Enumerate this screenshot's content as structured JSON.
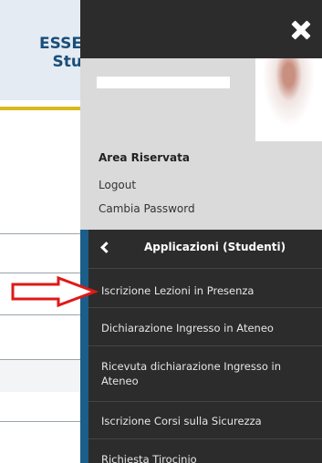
{
  "background": {
    "title_lines": [
      "ESSE",
      "Stu"
    ]
  },
  "menu": {
    "user": {
      "section_title": "Area Riservata",
      "logout": "Logout",
      "change_password": "Cambia Password"
    },
    "submenu": {
      "title": "Applicazioni (Studenti)",
      "items": [
        {
          "label": "Iscrizione Lezioni in Presenza"
        },
        {
          "label": "Dichiarazione Ingresso in Ateneo"
        },
        {
          "label": "Ricevuta dichiarazione Ingresso in Ateneo"
        },
        {
          "label": "Iscrizione Corsi sulla Sicurezza"
        },
        {
          "label": "Richiesta Tirocinio"
        }
      ]
    }
  },
  "colors": {
    "panel_bg": "#2c2c2c",
    "accent_blue": "#1b5e8a",
    "arrow_red": "#e01818",
    "user_area_bg": "#dadada"
  },
  "icons": {
    "close": "close-icon",
    "back": "chevron-left-icon",
    "annotation": "red-arrow-icon"
  }
}
